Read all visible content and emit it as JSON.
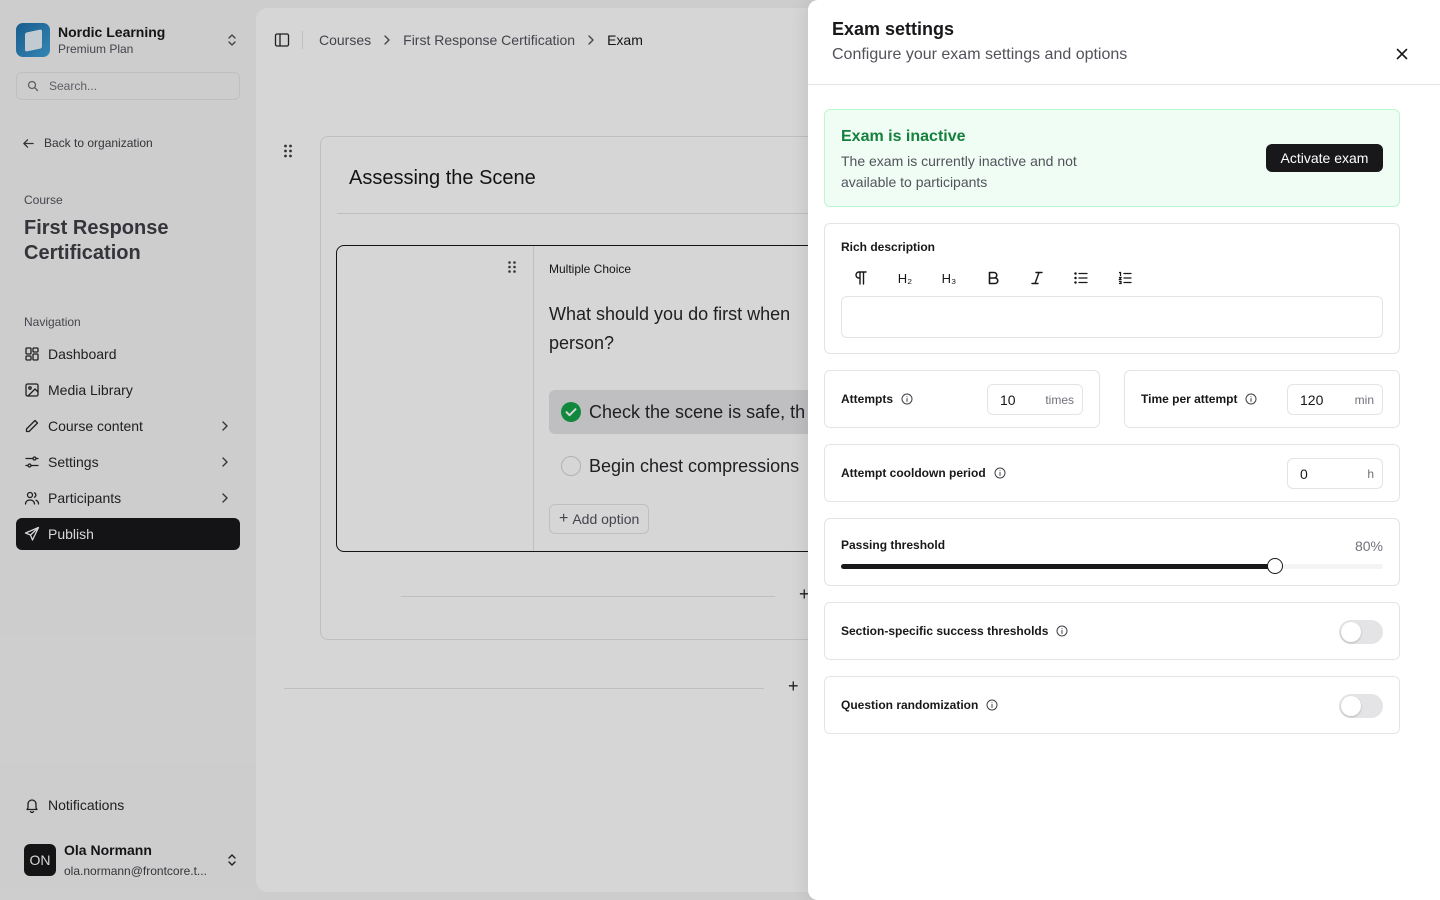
{
  "sidebar": {
    "org_name": "Nordic Learning",
    "org_plan": "Premium Plan",
    "search_placeholder": "Search...",
    "back_label": "Back to organization",
    "course_label": "Course",
    "course_title": "First Response Certification",
    "nav_label": "Navigation",
    "items": [
      {
        "label": "Dashboard",
        "icon": "dashboard-icon",
        "chevron": false,
        "active": false
      },
      {
        "label": "Media Library",
        "icon": "image-icon",
        "chevron": false,
        "active": false
      },
      {
        "label": "Course content",
        "icon": "pencil-icon",
        "chevron": true,
        "active": false
      },
      {
        "label": "Settings",
        "icon": "sliders-icon",
        "chevron": true,
        "active": false
      },
      {
        "label": "Participants",
        "icon": "users-icon",
        "chevron": true,
        "active": false
      },
      {
        "label": "Publish",
        "icon": "send-icon",
        "chevron": false,
        "active": true
      }
    ],
    "notifications_label": "Notifications",
    "user": {
      "initials": "ON",
      "name": "Ola Normann",
      "email": "ola.normann@frontcore.t..."
    }
  },
  "breadcrumb": [
    "Courses",
    "First Response Certification",
    "Exam"
  ],
  "editor": {
    "section_title": "Assessing the Scene",
    "question_type": "Multiple Choice",
    "question_text": "What should you do first when",
    "question_text_line2": "person?",
    "options": [
      {
        "text": "Check the scene is safe, th",
        "correct": true
      },
      {
        "text": "Begin chest compressions",
        "correct": false
      }
    ],
    "add_option_label": "Add option"
  },
  "drawer": {
    "title": "Exam settings",
    "subtitle": "Configure your exam settings and options",
    "status": {
      "title": "Exam is inactive",
      "description": "The exam is currently inactive and not available to participants",
      "action_label": "Activate exam",
      "accent_color": "#15803d"
    },
    "rich_description": {
      "label": "Rich description",
      "toolbar": [
        "paragraph-icon",
        "heading-2-icon",
        "heading-3-icon",
        "bold-icon",
        "italic-icon",
        "bullet-list-icon",
        "ordered-list-icon"
      ],
      "h2_label": "H₂",
      "h3_label": "H₃"
    },
    "attempts": {
      "label": "Attempts",
      "value": "10",
      "unit": "times"
    },
    "time_per_attempt": {
      "label": "Time per attempt",
      "value": "120",
      "unit": "min"
    },
    "cooldown": {
      "label": "Attempt cooldown period",
      "value": "0",
      "unit": "h"
    },
    "passing_threshold": {
      "label": "Passing threshold",
      "value_label": "80%",
      "value": 0.8
    },
    "section_thresholds": {
      "label": "Section-specific success thresholds",
      "enabled": false
    },
    "randomization": {
      "label": "Question randomization",
      "enabled": false
    }
  }
}
